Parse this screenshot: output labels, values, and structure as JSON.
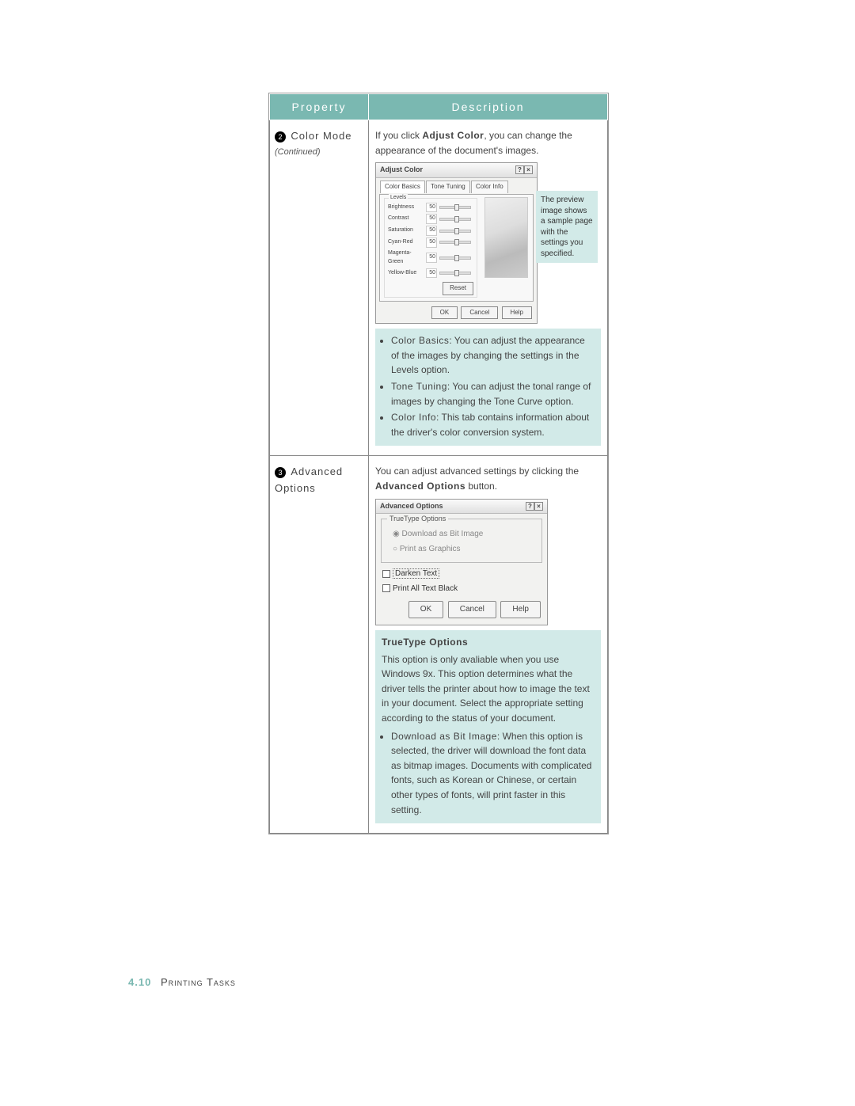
{
  "table": {
    "header_property": "Property",
    "header_description": "Description"
  },
  "row1": {
    "num": "2",
    "label": "Color Mode",
    "continued": "(Continued)",
    "intro_a": "If you click ",
    "intro_bold": "Adjust Color",
    "intro_b": ", you can change the appearance of the document's images.",
    "callout": "The preview image shows a sample page with the settings you specified.",
    "bullets": {
      "b1_term": "Color Basics",
      "b1_rest": ": You can adjust the appearance of the images by changing the settings in the Levels option.",
      "b2_term": "Tone Tuning",
      "b2_rest": ": You can adjust the tonal range of images by changing the Tone Curve option.",
      "b3_term": "Color Info",
      "b3_rest": ": This tab contains information about the driver's color conversion system."
    }
  },
  "adjust_dialog": {
    "title": "Adjust Color",
    "tabs": {
      "t1": "Color Basics",
      "t2": "Tone Tuning",
      "t3": "Color Info"
    },
    "levels_label": "Levels",
    "sliders": {
      "brightness": "Brightness",
      "contrast": "Contrast",
      "saturation": "Saturation",
      "cyanred": "Cyan-Red",
      "magentagreen": "Magenta-Green",
      "yellowblue": "Yellow-Blue",
      "val": "50"
    },
    "reset": "Reset",
    "ok": "OK",
    "cancel": "Cancel",
    "help": "Help"
  },
  "row2": {
    "num": "3",
    "label": "Advanced Options",
    "intro_a": "You can adjust advanced settings by clicking the ",
    "intro_bold": "Advanced Options",
    "intro_b": " button.",
    "tt_heading": "TrueType Options",
    "tt_body": "This option is only avaliable when you use Windows 9x. This option determines what the driver tells the printer about how to image the text in your document. Select the appropriate setting according to the status of your document.",
    "tt_b1_term": "Download as Bit Image",
    "tt_b1_rest": ": When this option is selected, the driver will download the font data as bitmap images. Documents with complicated fonts, such as Korean or Chinese, or certain other types of fonts, will print faster in this setting."
  },
  "adv_dialog": {
    "title": "Advanced Options",
    "group": "TrueType Options",
    "r1": "Download as Bit Image",
    "r2": "Print as Graphics",
    "c1": "Darken Text",
    "c2": "Print All Text Black",
    "ok": "OK",
    "cancel": "Cancel",
    "help": "Help"
  },
  "footer": {
    "pagenum": "4.10",
    "section": "Printing Tasks"
  }
}
